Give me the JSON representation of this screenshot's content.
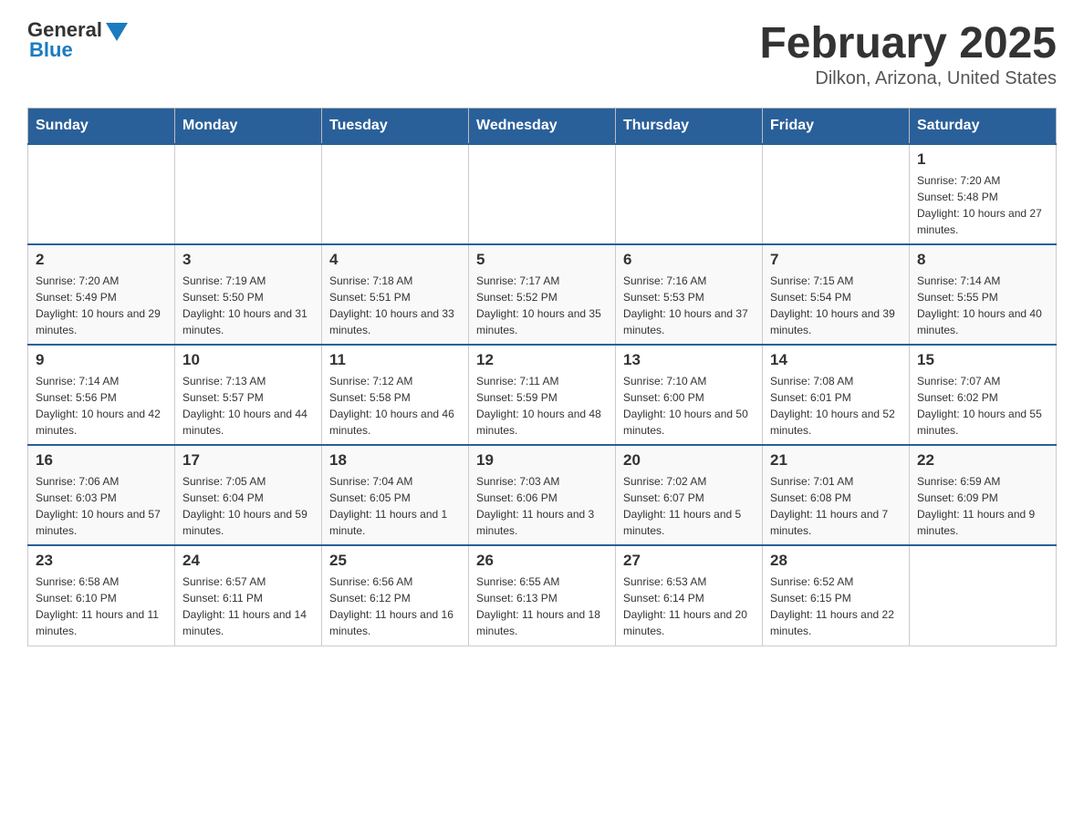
{
  "header": {
    "logo_general": "General",
    "logo_blue": "Blue",
    "month_title": "February 2025",
    "location": "Dilkon, Arizona, United States"
  },
  "weekdays": [
    "Sunday",
    "Monday",
    "Tuesday",
    "Wednesday",
    "Thursday",
    "Friday",
    "Saturday"
  ],
  "weeks": [
    {
      "days": [
        {
          "date": "",
          "info": ""
        },
        {
          "date": "",
          "info": ""
        },
        {
          "date": "",
          "info": ""
        },
        {
          "date": "",
          "info": ""
        },
        {
          "date": "",
          "info": ""
        },
        {
          "date": "",
          "info": ""
        },
        {
          "date": "1",
          "info": "Sunrise: 7:20 AM\nSunset: 5:48 PM\nDaylight: 10 hours and 27 minutes."
        }
      ]
    },
    {
      "days": [
        {
          "date": "2",
          "info": "Sunrise: 7:20 AM\nSunset: 5:49 PM\nDaylight: 10 hours and 29 minutes."
        },
        {
          "date": "3",
          "info": "Sunrise: 7:19 AM\nSunset: 5:50 PM\nDaylight: 10 hours and 31 minutes."
        },
        {
          "date": "4",
          "info": "Sunrise: 7:18 AM\nSunset: 5:51 PM\nDaylight: 10 hours and 33 minutes."
        },
        {
          "date": "5",
          "info": "Sunrise: 7:17 AM\nSunset: 5:52 PM\nDaylight: 10 hours and 35 minutes."
        },
        {
          "date": "6",
          "info": "Sunrise: 7:16 AM\nSunset: 5:53 PM\nDaylight: 10 hours and 37 minutes."
        },
        {
          "date": "7",
          "info": "Sunrise: 7:15 AM\nSunset: 5:54 PM\nDaylight: 10 hours and 39 minutes."
        },
        {
          "date": "8",
          "info": "Sunrise: 7:14 AM\nSunset: 5:55 PM\nDaylight: 10 hours and 40 minutes."
        }
      ]
    },
    {
      "days": [
        {
          "date": "9",
          "info": "Sunrise: 7:14 AM\nSunset: 5:56 PM\nDaylight: 10 hours and 42 minutes."
        },
        {
          "date": "10",
          "info": "Sunrise: 7:13 AM\nSunset: 5:57 PM\nDaylight: 10 hours and 44 minutes."
        },
        {
          "date": "11",
          "info": "Sunrise: 7:12 AM\nSunset: 5:58 PM\nDaylight: 10 hours and 46 minutes."
        },
        {
          "date": "12",
          "info": "Sunrise: 7:11 AM\nSunset: 5:59 PM\nDaylight: 10 hours and 48 minutes."
        },
        {
          "date": "13",
          "info": "Sunrise: 7:10 AM\nSunset: 6:00 PM\nDaylight: 10 hours and 50 minutes."
        },
        {
          "date": "14",
          "info": "Sunrise: 7:08 AM\nSunset: 6:01 PM\nDaylight: 10 hours and 52 minutes."
        },
        {
          "date": "15",
          "info": "Sunrise: 7:07 AM\nSunset: 6:02 PM\nDaylight: 10 hours and 55 minutes."
        }
      ]
    },
    {
      "days": [
        {
          "date": "16",
          "info": "Sunrise: 7:06 AM\nSunset: 6:03 PM\nDaylight: 10 hours and 57 minutes."
        },
        {
          "date": "17",
          "info": "Sunrise: 7:05 AM\nSunset: 6:04 PM\nDaylight: 10 hours and 59 minutes."
        },
        {
          "date": "18",
          "info": "Sunrise: 7:04 AM\nSunset: 6:05 PM\nDaylight: 11 hours and 1 minute."
        },
        {
          "date": "19",
          "info": "Sunrise: 7:03 AM\nSunset: 6:06 PM\nDaylight: 11 hours and 3 minutes."
        },
        {
          "date": "20",
          "info": "Sunrise: 7:02 AM\nSunset: 6:07 PM\nDaylight: 11 hours and 5 minutes."
        },
        {
          "date": "21",
          "info": "Sunrise: 7:01 AM\nSunset: 6:08 PM\nDaylight: 11 hours and 7 minutes."
        },
        {
          "date": "22",
          "info": "Sunrise: 6:59 AM\nSunset: 6:09 PM\nDaylight: 11 hours and 9 minutes."
        }
      ]
    },
    {
      "days": [
        {
          "date": "23",
          "info": "Sunrise: 6:58 AM\nSunset: 6:10 PM\nDaylight: 11 hours and 11 minutes."
        },
        {
          "date": "24",
          "info": "Sunrise: 6:57 AM\nSunset: 6:11 PM\nDaylight: 11 hours and 14 minutes."
        },
        {
          "date": "25",
          "info": "Sunrise: 6:56 AM\nSunset: 6:12 PM\nDaylight: 11 hours and 16 minutes."
        },
        {
          "date": "26",
          "info": "Sunrise: 6:55 AM\nSunset: 6:13 PM\nDaylight: 11 hours and 18 minutes."
        },
        {
          "date": "27",
          "info": "Sunrise: 6:53 AM\nSunset: 6:14 PM\nDaylight: 11 hours and 20 minutes."
        },
        {
          "date": "28",
          "info": "Sunrise: 6:52 AM\nSunset: 6:15 PM\nDaylight: 11 hours and 22 minutes."
        },
        {
          "date": "",
          "info": ""
        }
      ]
    }
  ]
}
